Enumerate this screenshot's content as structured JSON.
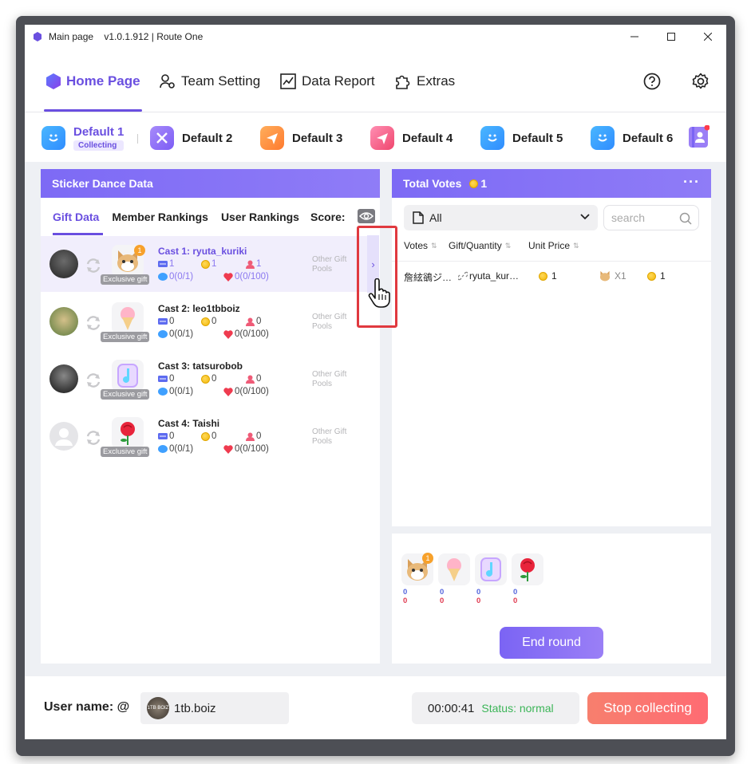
{
  "window": {
    "title": "Main page    v1.0.1.912 | Route One"
  },
  "nav": {
    "items": [
      {
        "label": "Home Page",
        "icon": "hexagon-icon",
        "active": true
      },
      {
        "label": "Team Setting",
        "icon": "team-gear-icon"
      },
      {
        "label": "Data Report",
        "icon": "chart-icon"
      },
      {
        "label": "Extras",
        "icon": "puzzle-icon"
      }
    ],
    "help_icon": "help-icon",
    "settings_icon": "gear-icon"
  },
  "rooms": {
    "items": [
      {
        "label": "Default 1",
        "status": "Collecting",
        "active": true
      },
      {
        "label": "Default 2"
      },
      {
        "label": "Default 3"
      },
      {
        "label": "Default 4"
      },
      {
        "label": "Default 5"
      },
      {
        "label": "Default 6"
      }
    ]
  },
  "left_panel": {
    "title": "Sticker Dance Data",
    "tabs": [
      "Gift Data",
      "Member Rankings",
      "User Rankings",
      "Score:"
    ],
    "casts": [
      {
        "name": "Cast 1:  ryuta_kuriki",
        "gift_badge": "1",
        "exclusive": "Exclusive gift",
        "tickets": "1",
        "coins": "1",
        "users": "1",
        "comments": "0(0/1)",
        "hearts": "0(0/100)",
        "pools": [
          "Other Gift",
          "Pools"
        ]
      },
      {
        "name": "Cast 2:  leo1tbboiz",
        "exclusive": "Exclusive gift",
        "tickets": "0",
        "coins": "0",
        "users": "0",
        "comments": "0(0/1)",
        "hearts": "0(0/100)",
        "pools": [
          "Other Gift",
          "Pools"
        ]
      },
      {
        "name": "Cast 3:  tatsurobob",
        "exclusive": "Exclusive gift",
        "tickets": "0",
        "coins": "0",
        "users": "0",
        "comments": "0(0/1)",
        "hearts": "0(0/100)",
        "pools": [
          "Other Gift",
          "Pools"
        ]
      },
      {
        "name": "Cast 4:  Taishi",
        "exclusive": "Exclusive gift",
        "tickets": "0",
        "coins": "0",
        "users": "0",
        "comments": "0(0/1)",
        "hearts": "0(0/100)",
        "pools": [
          "Other Gift",
          "Pools"
        ]
      }
    ],
    "expander": "›"
  },
  "right_panel": {
    "title": "Total Votes",
    "total": "1",
    "filter_value": "All",
    "search_placeholder": "search",
    "columns": [
      "Votes",
      "Gift/Quantity",
      "Unit Price"
    ],
    "rows": [
      {
        "user": "詹絃鵒ジ…",
        "cast": "ryuta_kur…",
        "votes": "1",
        "quantity": "X1",
        "unit_price": "1"
      }
    ],
    "gift_summary": [
      {
        "comments": "0",
        "hearts": "0",
        "badge": "1"
      },
      {
        "comments": "0",
        "hearts": "0"
      },
      {
        "comments": "0",
        "hearts": "0"
      },
      {
        "comments": "0",
        "hearts": "0"
      }
    ],
    "end_round": "End round"
  },
  "bottom": {
    "user_label": "User name: @",
    "user_value": "1tb.boiz",
    "avatar_text": "1TB BOIZ",
    "timer": "00:00:41",
    "status": "Status: normal",
    "stop_button": "Stop collecting"
  },
  "colors": {
    "accent": "#6a4fe0",
    "header": "#7d6af5",
    "stop": "#f77f6e",
    "status_ok": "#3cb558"
  }
}
